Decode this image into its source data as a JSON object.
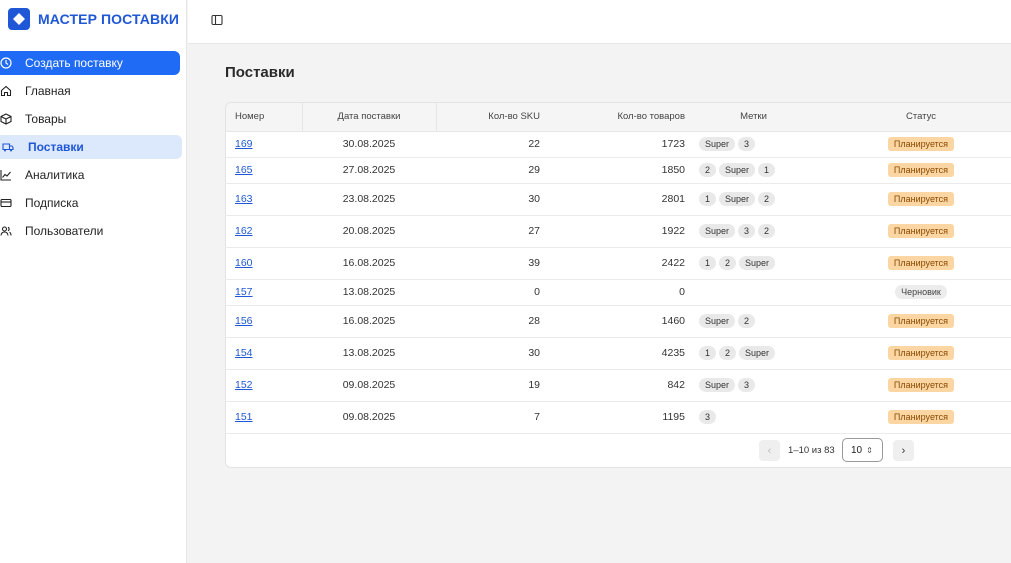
{
  "brand": {
    "name": "МАСТЕР ПОСТАВКИ",
    "color": "#1f57d6"
  },
  "sidebar": {
    "items": [
      {
        "label": "Создать поставку",
        "icon": "clock-icon",
        "state": "primary"
      },
      {
        "label": "Главная",
        "icon": "home-icon",
        "state": "default"
      },
      {
        "label": "Товары",
        "icon": "box-icon",
        "state": "default"
      },
      {
        "label": "Поставки",
        "icon": "truck-icon",
        "state": "active"
      },
      {
        "label": "Аналитика",
        "icon": "chart-icon",
        "state": "default"
      },
      {
        "label": "Подписка",
        "icon": "card-icon",
        "state": "default"
      },
      {
        "label": "Пользователи",
        "icon": "users-icon",
        "state": "default"
      }
    ]
  },
  "topbar": {
    "toggle_icon": "sidebar-toggle-icon"
  },
  "page": {
    "title": "Поставки"
  },
  "table": {
    "columns": [
      "Номер",
      "Дата поставки",
      "Кол-во SKU",
      "Кол-во товаров",
      "Метки",
      "Статус"
    ],
    "rows": [
      {
        "number": "169",
        "date": "30.08.2025",
        "sku": "22",
        "qty": "1723",
        "tags": [
          "Super",
          "3"
        ],
        "status": "Планируется",
        "status_type": "plan"
      },
      {
        "number": "165",
        "date": "27.08.2025",
        "sku": "29",
        "qty": "1850",
        "tags": [
          "2",
          "Super",
          "1"
        ],
        "status": "Планируется",
        "status_type": "plan"
      },
      {
        "number": "163",
        "date": "23.08.2025",
        "sku": "30",
        "qty": "2801",
        "tags": [
          "1",
          "Super",
          "2"
        ],
        "status": "Планируется",
        "status_type": "plan"
      },
      {
        "number": "162",
        "date": "20.08.2025",
        "sku": "27",
        "qty": "1922",
        "tags": [
          "Super",
          "3",
          "2"
        ],
        "status": "Планируется",
        "status_type": "plan"
      },
      {
        "number": "160",
        "date": "16.08.2025",
        "sku": "39",
        "qty": "2422",
        "tags": [
          "1",
          "2",
          "Super"
        ],
        "status": "Планируется",
        "status_type": "plan"
      },
      {
        "number": "157",
        "date": "13.08.2025",
        "sku": "0",
        "qty": "0",
        "tags": [],
        "status": "Черновик",
        "status_type": "draft"
      },
      {
        "number": "156",
        "date": "16.08.2025",
        "sku": "28",
        "qty": "1460",
        "tags": [
          "Super",
          "2"
        ],
        "status": "Планируется",
        "status_type": "plan"
      },
      {
        "number": "154",
        "date": "13.08.2025",
        "sku": "30",
        "qty": "4235",
        "tags": [
          "1",
          "2",
          "Super"
        ],
        "status": "Планируется",
        "status_type": "plan"
      },
      {
        "number": "152",
        "date": "09.08.2025",
        "sku": "19",
        "qty": "842",
        "tags": [
          "Super",
          "3"
        ],
        "status": "Планируется",
        "status_type": "plan"
      },
      {
        "number": "151",
        "date": "09.08.2025",
        "sku": "7",
        "qty": "1195",
        "tags": [
          "3"
        ],
        "status": "Планируется",
        "status_type": "plan"
      }
    ],
    "row_heights": [
      26,
      26,
      32,
      32,
      32,
      26,
      32,
      32,
      32,
      32
    ]
  },
  "pagination": {
    "range_label": "1–10 из 83",
    "page_size": "10",
    "prev_icon": "chevron-left-icon",
    "next_icon": "chevron-right-icon"
  },
  "colors": {
    "primary": "#1f6bf5",
    "active_bg": "#dce8fb",
    "status_plan_bg": "#fbd6a3",
    "status_plan_text": "#8a4a00",
    "link": "#1f57d6"
  }
}
